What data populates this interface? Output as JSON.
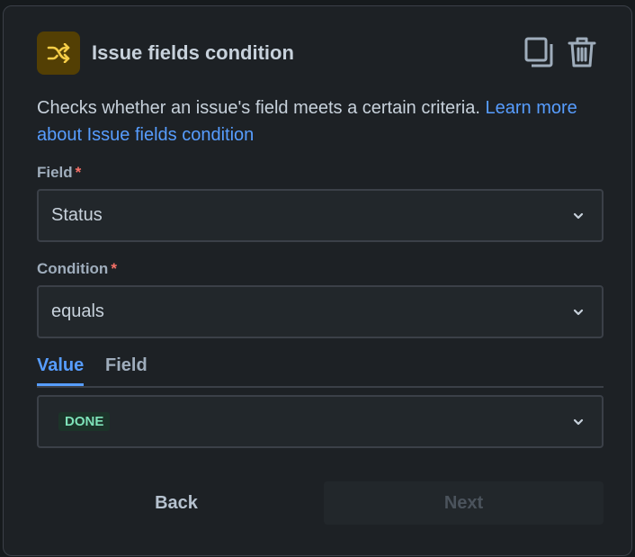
{
  "header": {
    "title": "Issue fields condition",
    "icon": "shuffle-icon",
    "icon_color": "#f5cd47",
    "actions": [
      "duplicate-icon",
      "trash-icon"
    ]
  },
  "description": {
    "text": "Checks whether an issue's field meets a certain criteria. ",
    "link": "Learn more about Issue fields condition"
  },
  "form": {
    "field": {
      "label": "Field",
      "required_mark": "*",
      "value": "Status"
    },
    "condition": {
      "label": "Condition",
      "required_mark": "*",
      "value": "equals"
    },
    "tabs": [
      {
        "label": "Value",
        "active": true
      },
      {
        "label": "Field",
        "active": false
      }
    ],
    "value": {
      "lozenge": "DONE",
      "lozenge_color": "#7ee2b8"
    }
  },
  "footer": {
    "back_label": "Back",
    "next_label": "Next",
    "next_disabled": true
  },
  "colors": {
    "accent": "#579dff",
    "required": "#f87168"
  }
}
